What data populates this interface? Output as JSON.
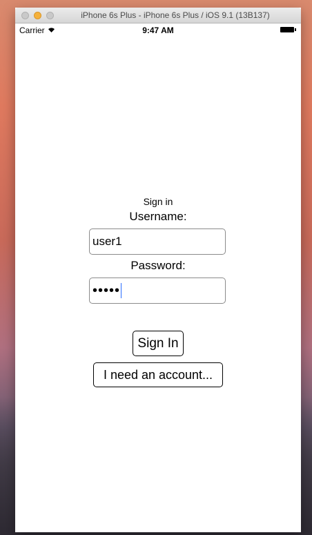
{
  "window": {
    "title": "iPhone 6s Plus - iPhone 6s Plus / iOS 9.1 (13B137)"
  },
  "statusbar": {
    "carrier": "Carrier",
    "wifi_icon": "wifi-icon",
    "time": "9:47 AM",
    "battery_icon": "battery-icon"
  },
  "form": {
    "heading": "Sign in",
    "username_label": "Username:",
    "username_value": "user1",
    "password_label": "Password:",
    "password_value": "•••••",
    "signin_button": "Sign In",
    "account_button": "I need an account..."
  }
}
